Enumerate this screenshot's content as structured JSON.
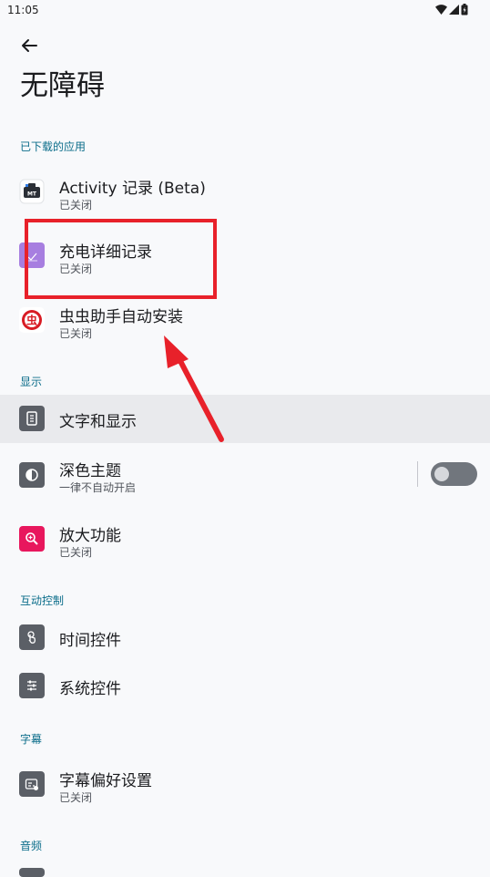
{
  "status_bar": {
    "time": "11:05"
  },
  "header": {
    "title": "无障碍"
  },
  "sections": {
    "downloaded": "已下载的应用",
    "display": "显示",
    "interaction": "互动控制",
    "captions": "字幕",
    "audio": "音频"
  },
  "downloaded_apps": [
    {
      "title": "Activity 记录 (Beta)",
      "subtitle": "已关闭"
    },
    {
      "title": "充电详细记录",
      "subtitle": "已关闭"
    },
    {
      "title": "虫虫助手自动安装",
      "subtitle": "已关闭"
    }
  ],
  "app_icons": {
    "activity_label": "MT",
    "bug_char": "虫"
  },
  "display_items": {
    "text_display": {
      "title": "文字和显示"
    },
    "dark_theme": {
      "title": "深色主题",
      "subtitle": "一律不自动开启",
      "toggle_on": false
    },
    "magnification": {
      "title": "放大功能",
      "subtitle": "已关闭"
    }
  },
  "interaction_items": [
    {
      "title": "时间控件"
    },
    {
      "title": "系统控件"
    }
  ],
  "caption_items": [
    {
      "title": "字幕偏好设置",
      "subtitle": "已关闭"
    }
  ],
  "colors": {
    "section_header": "#0b6d8a",
    "annotation_red": "#e8212a",
    "magnify_pink": "#e8175d",
    "charge_purple": "#a77ee0"
  }
}
